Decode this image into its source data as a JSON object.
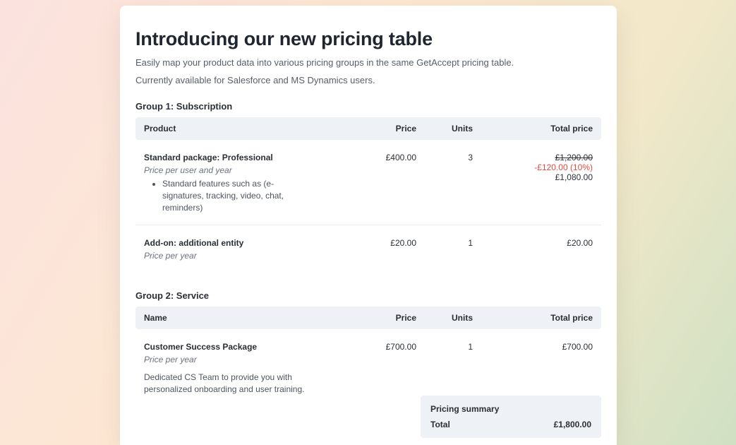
{
  "header": {
    "title": "Introducing our new pricing table",
    "subtitle1": "Easily map your product data into various pricing groups in the same GetAccept pricing table.",
    "subtitle2": "Currently available for Salesforce and MS Dynamics users."
  },
  "group1": {
    "label": "Group 1: Subscription",
    "columns": {
      "c1": "Product",
      "c2": "Price",
      "c3": "Units",
      "c4": "Total price"
    },
    "rows": [
      {
        "name": "Standard package: Professional",
        "unit": "Price per user and year",
        "feature": "Standard features such as (e-signatures, tracking, video, chat, reminders)",
        "price": "£400.00",
        "units": "3",
        "orig": "£1,200.00",
        "discount": "-£120.00 (10%)",
        "final": "£1,080.00"
      },
      {
        "name": "Add-on: additional entity",
        "unit": "Price per year",
        "price": "£20.00",
        "units": "1",
        "final": "£20.00"
      }
    ]
  },
  "group2": {
    "label": "Group 2: Service",
    "columns": {
      "c1": "Name",
      "c2": "Price",
      "c3": "Units",
      "c4": "Total price"
    },
    "rows": [
      {
        "name": "Customer Success Package",
        "unit": "Price per year",
        "desc": "Dedicated CS Team to provide you with personalized onboarding and user training.",
        "price": "£700.00",
        "units": "1",
        "final": "£700.00"
      }
    ]
  },
  "summary": {
    "header": "Pricing summary",
    "total_label": "Total",
    "total_value": "£1,800.00"
  }
}
